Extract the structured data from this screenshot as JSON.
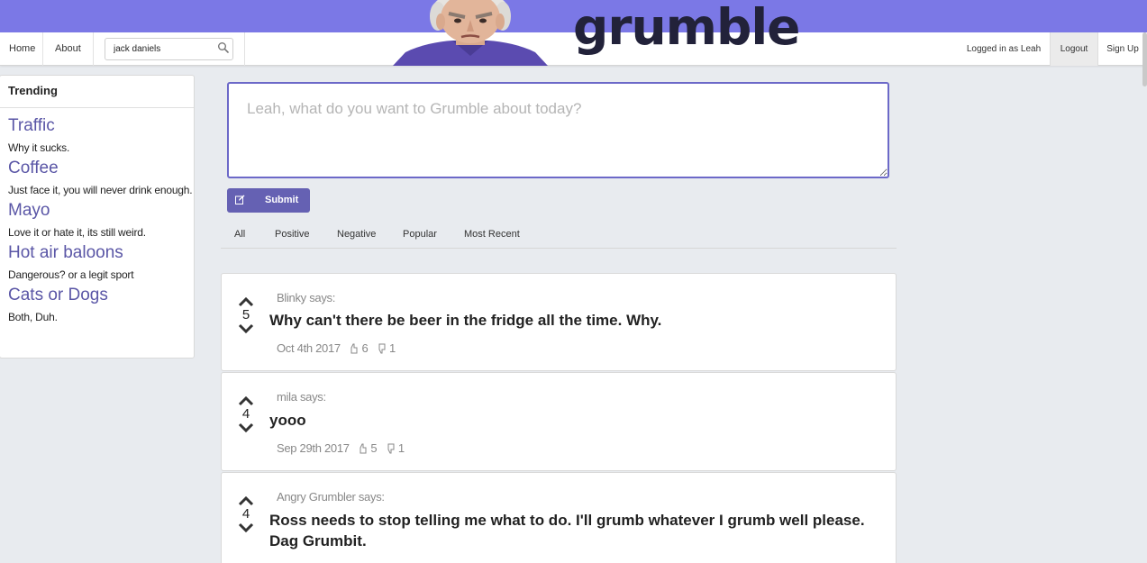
{
  "app": {
    "logo_text": "grumble"
  },
  "nav": {
    "home_label": "Home",
    "about_label": "About",
    "search_value": "jack daniels",
    "logged_in_text": "Logged in as Leah",
    "logout_label": "Logout",
    "signup_label": "Sign Up"
  },
  "sidebar": {
    "header": "Trending",
    "items": [
      {
        "title": "Traffic",
        "desc": "Why it sucks."
      },
      {
        "title": "Coffee",
        "desc": "Just face it, you will never drink enough."
      },
      {
        "title": "Mayo",
        "desc": "Love it or hate it, its still weird."
      },
      {
        "title": "Hot air baloons",
        "desc": "Dangerous? or a legit sport"
      },
      {
        "title": "Cats or Dogs",
        "desc": "Both, Duh."
      }
    ]
  },
  "compose": {
    "placeholder": "Leah, what do you want to Grumble about today?",
    "submit_label": "Submit"
  },
  "filters": [
    "All",
    "Positive",
    "Negative",
    "Popular",
    "Most Recent"
  ],
  "posts": [
    {
      "score": "5",
      "author": "Blinky says:",
      "text": "Why can't there be beer in the fridge all the time. Why.",
      "date": "Oct 4th 2017",
      "likes": "6",
      "dislikes": "1"
    },
    {
      "score": "4",
      "author": "mila says:",
      "text": "yooo",
      "date": "Sep 29th 2017",
      "likes": "5",
      "dislikes": "1"
    },
    {
      "score": "4",
      "author": "Angry Grumbler says:",
      "text": "Ross needs to stop telling me what to do. I'll grumb whatever I grumb well please. Dag Grumbit."
    }
  ],
  "colors": {
    "banner": "#7b78e6",
    "accent": "#6561b3",
    "trend_link": "#5a56a6"
  }
}
